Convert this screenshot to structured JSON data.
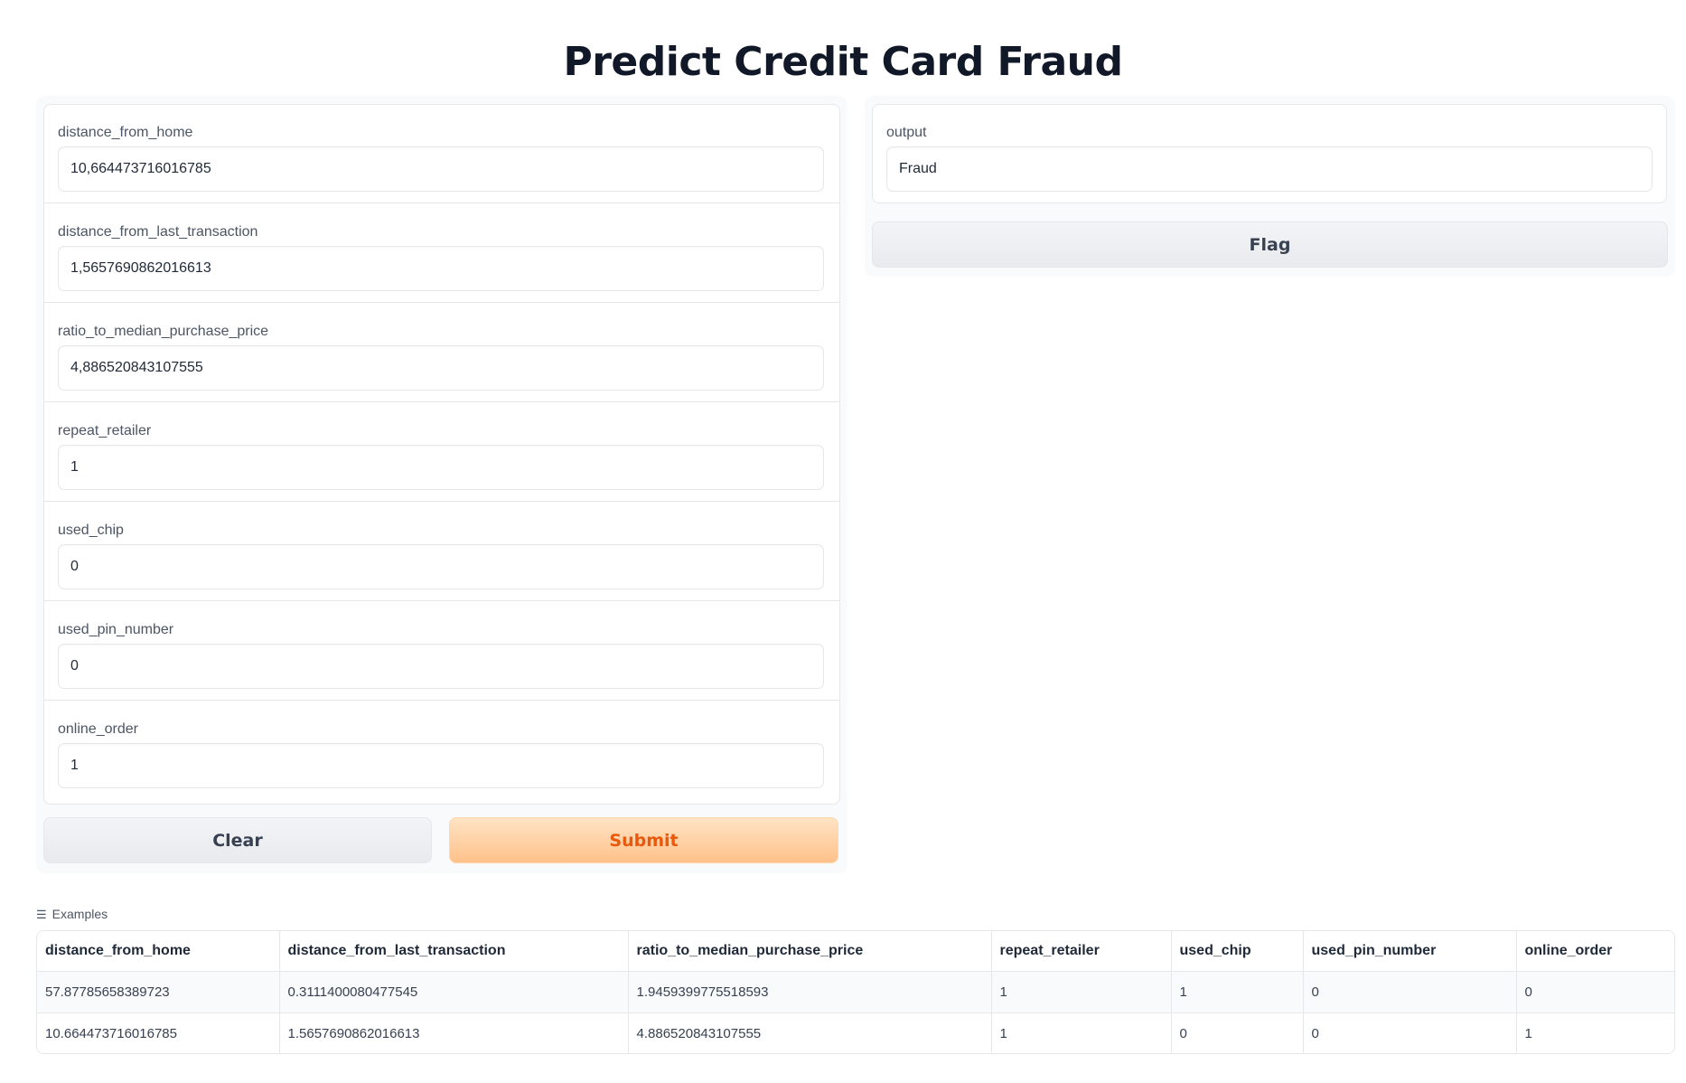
{
  "page": {
    "title": "Predict Credit Card Fraud"
  },
  "inputs": [
    {
      "label": "distance_from_home",
      "value": "10,664473716016785"
    },
    {
      "label": "distance_from_last_transaction",
      "value": "1,5657690862016613"
    },
    {
      "label": "ratio_to_median_purchase_price",
      "value": "4,886520843107555"
    },
    {
      "label": "repeat_retailer",
      "value": "1"
    },
    {
      "label": "used_chip",
      "value": "0"
    },
    {
      "label": "used_pin_number",
      "value": "0"
    },
    {
      "label": "online_order",
      "value": "1"
    }
  ],
  "buttons": {
    "clear": "Clear",
    "submit": "Submit",
    "flag": "Flag"
  },
  "output": {
    "label": "output",
    "value": "Fraud"
  },
  "examples": {
    "label": "Examples",
    "icon": "list-icon",
    "headers": [
      "distance_from_home",
      "distance_from_last_transaction",
      "ratio_to_median_purchase_price",
      "repeat_retailer",
      "used_chip",
      "used_pin_number",
      "online_order"
    ],
    "rows": [
      [
        "57.87785658389723",
        "0.3111400080477545",
        "1.9459399775518593",
        "1",
        "1",
        "0",
        "0"
      ],
      [
        "10.664473716016785",
        "1.5657690862016613",
        "4.886520843107555",
        "1",
        "0",
        "0",
        "1"
      ]
    ]
  },
  "colors": {
    "accent": "#ea580c",
    "submit_bg": "#ffc18a",
    "panel_bg": "#f9fafb",
    "border": "#e5e7eb"
  }
}
